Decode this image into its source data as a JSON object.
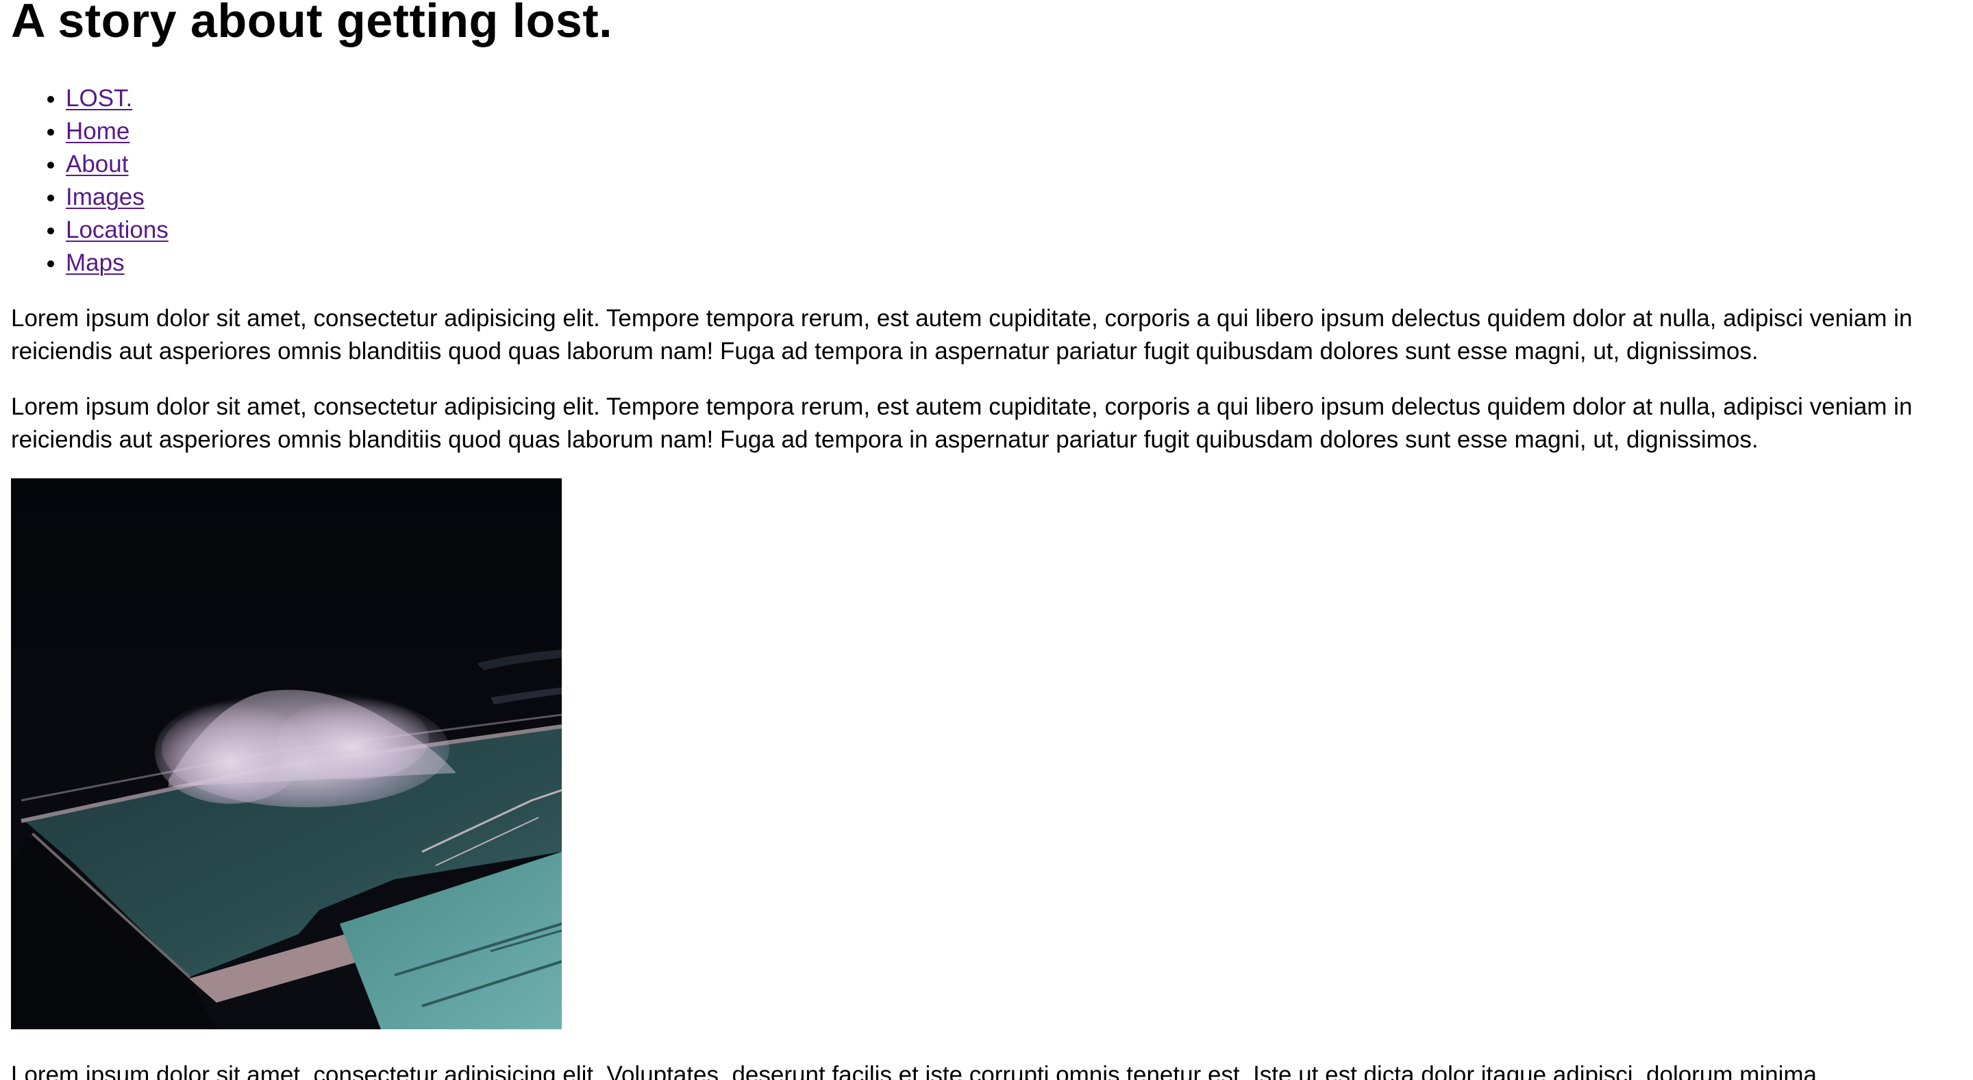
{
  "page": {
    "title": "A story about getting lost."
  },
  "nav": {
    "items": [
      {
        "label": "LOST."
      },
      {
        "label": "Home"
      },
      {
        "label": "About"
      },
      {
        "label": "Images"
      },
      {
        "label": "Locations"
      },
      {
        "label": "Maps"
      }
    ],
    "link_color": "#551a8b"
  },
  "content": {
    "paragraph_1": "Lorem ipsum dolor sit amet, consectetur adipisicing elit. Tempore tempora rerum, est autem cupiditate, corporis a qui libero ipsum delectus quidem dolor at nulla, adipisci veniam in reiciendis aut asperiores omnis blanditiis quod quas laborum nam! Fuga ad tempora in aspernatur pariatur fugit quibusdam dolores sunt esse magni, ut, dignissimos.",
    "paragraph_2": "Lorem ipsum dolor sit amet, consectetur adipisicing elit. Tempore tempora rerum, est autem cupiditate, corporis a qui libero ipsum delectus quidem dolor at nulla, adipisci veniam in reiciendis aut asperiores omnis blanditiis quod quas laborum nam! Fuga ad tempora in aspernatur pariatur fugit quibusdam dolores sunt esse magni, ut, dignissimos.",
    "paragraph_3": "Lorem ipsum dolor sit amet, consectetur adipisicing elit. Voluptates, deserunt facilis et iste corrupti omnis tenetur est. Iste ut est dicta dolor itaque adipisci, dolorum minima,"
  },
  "image": {
    "subject": "ocean-pool-wave-photo"
  }
}
